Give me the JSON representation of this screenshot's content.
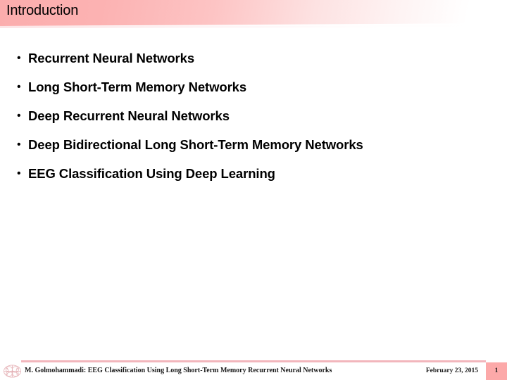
{
  "slide": {
    "title": "Introduction",
    "bullets": [
      {
        "marker": "•",
        "text": "Recurrent Neural Networks"
      },
      {
        "marker": "•",
        "text": "Long Short-Term Memory Networks"
      },
      {
        "marker": "•",
        "text": "Deep Recurrent Neural Networks"
      },
      {
        "marker": "•",
        "text": "Deep Bidirectional Long Short-Term Memory Networks"
      },
      {
        "marker": "•",
        "text": "EEG Classification Using Deep Learning"
      }
    ]
  },
  "footer": {
    "logo_icon": "brain-logo-icon",
    "citation": "M. Golmohammadi: EEG Classification Using Long Short-Term Memory Recurrent Neural Networks",
    "date": "February 23, 2015",
    "page_number": "1"
  },
  "colors": {
    "banner_start": "#fbadad",
    "banner_end": "#ffffff",
    "rule": "#f2b6bc",
    "page_box": "#fca9a9",
    "text": "#000000",
    "background": "#ffffff"
  }
}
